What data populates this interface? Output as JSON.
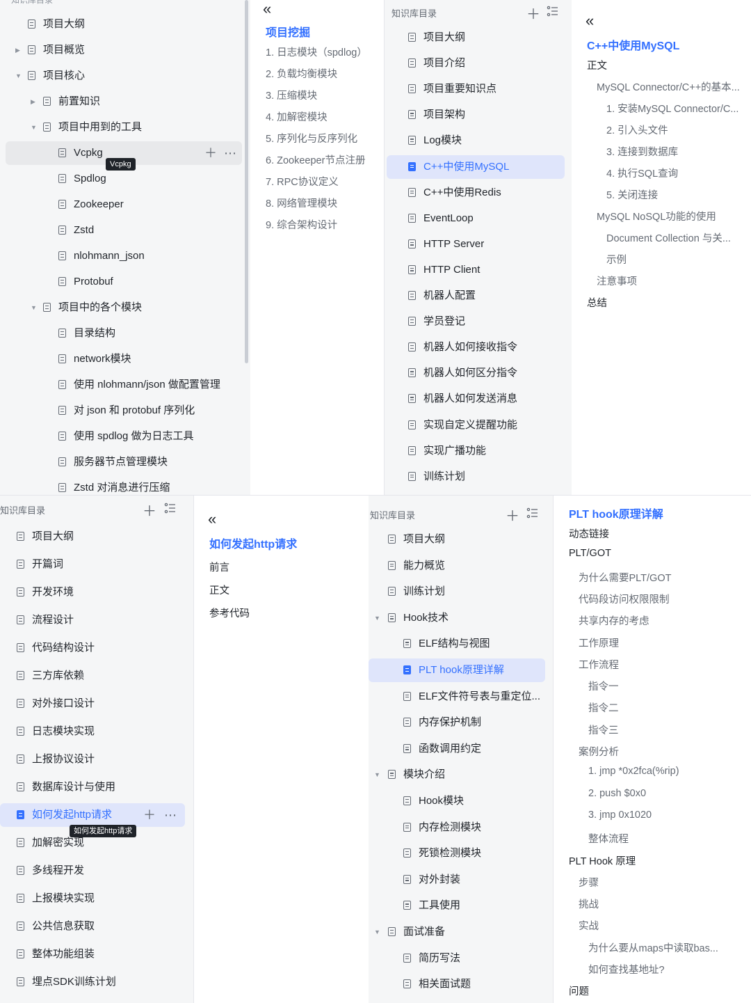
{
  "p1": {
    "header_partial": "知识库目录",
    "items": [
      {
        "label": "项目大纲"
      },
      {
        "label": "项目概览"
      },
      {
        "label": "项目核心"
      },
      {
        "label": "前置知识"
      },
      {
        "label": "项目中用到的工具"
      },
      {
        "label": "Vcpkg"
      },
      {
        "label": "Spdlog"
      },
      {
        "label": "Zookeeper"
      },
      {
        "label": "Zstd"
      },
      {
        "label": "nlohmann_json"
      },
      {
        "label": "Protobuf"
      },
      {
        "label": "项目中的各个模块"
      },
      {
        "label": "目录结构"
      },
      {
        "label": "network模块"
      },
      {
        "label": "使用 nlohmann/json 做配置管理"
      },
      {
        "label": "对 json 和 protobuf 序列化"
      },
      {
        "label": "使用 spdlog 做为日志工具"
      },
      {
        "label": "服务器节点管理模块"
      },
      {
        "label": "Zstd 对消息进行压缩"
      }
    ],
    "tooltip": "Vcpkg"
  },
  "p2": {
    "title": "项目挖掘",
    "items": [
      {
        "label": "1. 日志模块（spdlog）"
      },
      {
        "label": "2. 负载均衡模块"
      },
      {
        "label": "3. 压缩模块"
      },
      {
        "label": "4. 加解密模块"
      },
      {
        "label": "5. 序列化与反序列化"
      },
      {
        "label": "6. Zookeeper节点注册"
      },
      {
        "label": "7. RPC协议定义"
      },
      {
        "label": "8. 网络管理模块"
      },
      {
        "label": "9. 综合架构设计"
      }
    ]
  },
  "p3": {
    "header": "知识库目录",
    "items": [
      {
        "label": "项目大纲"
      },
      {
        "label": "项目介绍"
      },
      {
        "label": "项目重要知识点"
      },
      {
        "label": "项目架构"
      },
      {
        "label": "Log模块"
      },
      {
        "label": "C++中使用MySQL"
      },
      {
        "label": "C++中使用Redis"
      },
      {
        "label": "EventLoop"
      },
      {
        "label": "HTTP Server"
      },
      {
        "label": "HTTP Client"
      },
      {
        "label": "机器人配置"
      },
      {
        "label": "学员登记"
      },
      {
        "label": "机器人如何接收指令"
      },
      {
        "label": "机器人如何区分指令"
      },
      {
        "label": "机器人如何发送消息"
      },
      {
        "label": "实现自定义提醒功能"
      },
      {
        "label": "实现广播功能"
      },
      {
        "label": "训练计划"
      }
    ]
  },
  "p4": {
    "title": "C++中使用MySQL",
    "items": [
      {
        "label": "正文"
      },
      {
        "label": "MySQL Connector/C++的基本..."
      },
      {
        "label": "1. 安装MySQL Connector/C..."
      },
      {
        "label": "2. 引入头文件"
      },
      {
        "label": "3. 连接到数据库"
      },
      {
        "label": "4. 执行SQL查询"
      },
      {
        "label": "5. 关闭连接"
      },
      {
        "label": "MySQL NoSQL功能的使用"
      },
      {
        "label": "Document Collection 与关..."
      },
      {
        "label": "示例"
      },
      {
        "label": "注意事项"
      },
      {
        "label": "总结"
      }
    ]
  },
  "p5": {
    "header": "知识库目录",
    "items": [
      {
        "label": "项目大纲"
      },
      {
        "label": "开篇词"
      },
      {
        "label": "开发环境"
      },
      {
        "label": "流程设计"
      },
      {
        "label": "代码结构设计"
      },
      {
        "label": "三方库依赖"
      },
      {
        "label": "对外接口设计"
      },
      {
        "label": "日志模块实现"
      },
      {
        "label": "上报协议设计"
      },
      {
        "label": "数据库设计与使用"
      },
      {
        "label": "如何发起http请求"
      },
      {
        "label": "加解密实现"
      },
      {
        "label": "多线程开发"
      },
      {
        "label": "上报模块实现"
      },
      {
        "label": "公共信息获取"
      },
      {
        "label": "整体功能组装"
      },
      {
        "label": "埋点SDK训练计划"
      }
    ],
    "tooltip": "如何发起http请求"
  },
  "p6": {
    "title": "如何发起http请求",
    "items": [
      {
        "label": "前言"
      },
      {
        "label": "正文"
      },
      {
        "label": "参考代码"
      }
    ]
  },
  "p7": {
    "header": "知识库目录",
    "items": [
      {
        "label": "项目大纲"
      },
      {
        "label": "能力概览"
      },
      {
        "label": "训练计划"
      },
      {
        "label": "Hook技术"
      },
      {
        "label": "ELF结构与视图"
      },
      {
        "label": "PLT hook原理详解"
      },
      {
        "label": "ELF文件符号表与重定位..."
      },
      {
        "label": "内存保护机制"
      },
      {
        "label": "函数调用约定"
      },
      {
        "label": "模块介绍"
      },
      {
        "label": "Hook模块"
      },
      {
        "label": "内存检测模块"
      },
      {
        "label": "死锁检测模块"
      },
      {
        "label": "对外封装"
      },
      {
        "label": "工具使用"
      },
      {
        "label": "面试准备"
      },
      {
        "label": "简历写法"
      },
      {
        "label": "相关面试题"
      }
    ]
  },
  "p8": {
    "title": "PLT hook原理详解",
    "items": [
      {
        "label": "动态链接"
      },
      {
        "label": "PLT/GOT"
      },
      {
        "label": "为什么需要PLT/GOT"
      },
      {
        "label": "代码段访问权限限制"
      },
      {
        "label": "共享内存的考虑"
      },
      {
        "label": "工作原理"
      },
      {
        "label": "工作流程"
      },
      {
        "label": "指令一"
      },
      {
        "label": "指令二"
      },
      {
        "label": "指令三"
      },
      {
        "label": "案例分析"
      },
      {
        "label": "1. jmp *0x2fca(%rip)"
      },
      {
        "label": "2. push $0x0"
      },
      {
        "label": "3. jmp 0x1020"
      },
      {
        "label": "整体流程"
      },
      {
        "label": "PLT Hook 原理"
      },
      {
        "label": "步骤"
      },
      {
        "label": "挑战"
      },
      {
        "label": "实战"
      },
      {
        "label": "为什么要从maps中读取bas..."
      },
      {
        "label": "如何查找基地址?"
      },
      {
        "label": "问题"
      }
    ]
  },
  "icons": {
    "collapse": "double-chevron-left-icon",
    "doc": "document-icon",
    "add": "plus-icon",
    "more": "more-icon",
    "outline": "list-icon"
  },
  "colors": {
    "accent": "#3370ff",
    "active_bg": "#dfe5fb",
    "sidebar_bg": "#f5f6f7"
  }
}
